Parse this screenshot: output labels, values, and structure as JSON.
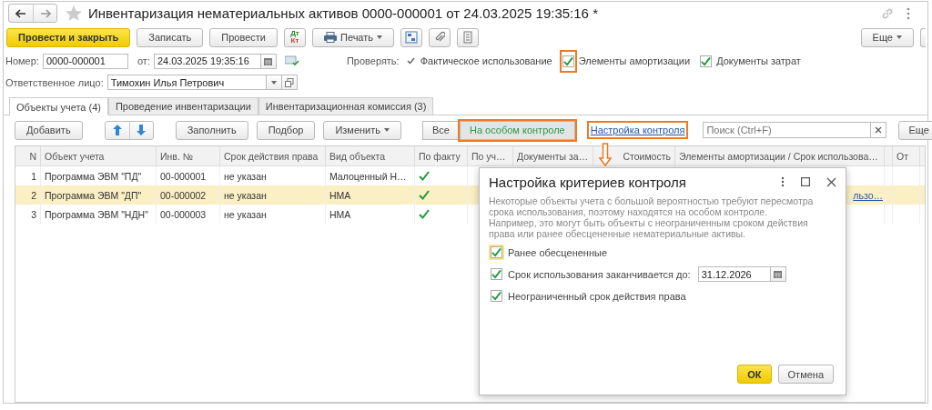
{
  "window": {
    "title": "Инвентаризация нематериальных активов 0000-000001 от 24.03.2025 19:35:16 *",
    "favorite": false
  },
  "toolbar": {
    "buttons": [
      {
        "kind": "primary",
        "label": "Провести и закрыть"
      },
      {
        "kind": "plain",
        "label": "Записать"
      },
      {
        "kind": "plain",
        "label": "Провести"
      },
      {
        "kind": "dtkt",
        "labels": [
          "Дт",
          "Кт"
        ]
      },
      {
        "kind": "print",
        "label": "Печать"
      },
      {
        "kind": "structure"
      },
      {
        "kind": "attach"
      },
      {
        "kind": "list"
      }
    ],
    "more": "Еще"
  },
  "header": {
    "number_label": "Номер:",
    "number": "0000-000001",
    "date_label": "от:",
    "date": "24.03.2025 19:35:16",
    "verify_label": "Проверять:",
    "checks": [
      {
        "kind": "mark",
        "label": "Фактическое использование",
        "checked": true
      },
      {
        "kind": "box",
        "label": "Элементы амортизации",
        "checked": true,
        "highlighted": true
      },
      {
        "kind": "box",
        "label": "Документы затрат",
        "checked": true,
        "highlighted": false
      }
    ],
    "responsible_label": "Ответственное лицо:",
    "responsible": "Тимохин Илья Петрович"
  },
  "tabs": [
    {
      "label": "Объекты учета (4)",
      "selected": true
    },
    {
      "label": "Проведение инвентаризации",
      "selected": false
    },
    {
      "label": "Инвентаризационная комиссия (3)",
      "selected": false
    }
  ],
  "table_toolbar": {
    "add": "Добавить",
    "fill": "Заполнить",
    "pick": "Подбор",
    "change": "Изменить",
    "filters": [
      {
        "label": "Все",
        "selected": false,
        "highlighted": false
      },
      {
        "label": "На особом контроле",
        "selected": true,
        "highlighted": true
      }
    ],
    "link": {
      "label": "Настройка контроля",
      "highlighted": true
    },
    "search_placeholder": "Поиск (Ctrl+F)",
    "more": "Еще"
  },
  "table": {
    "columns": [
      "N",
      "Объект учета",
      "Инв. №",
      "Срок действия права",
      "Вид объекта",
      "По факту",
      "По уч…",
      "Документы за…",
      "Стоимость",
      "Элементы амортизации / Срок использова…",
      "",
      "От"
    ],
    "rows": [
      {
        "n": "1",
        "object": "Программа ЭВМ  \"ПД\"",
        "inv": "00-000001",
        "term": "не указан",
        "type": "Малоценный Н…",
        "fact": true,
        "amort": "",
        "selected": false
      },
      {
        "n": "2",
        "object": "Программа ЭВМ  \"ДП\"",
        "inv": "00-000002",
        "term": "не указан",
        "type": "НМА",
        "fact": true,
        "amort": "льзо…",
        "selected": true
      },
      {
        "n": "3",
        "object": "Программа ЭВМ \"НДН\"",
        "inv": "00-000003",
        "term": "не указан",
        "type": "НМА",
        "fact": true,
        "amort": "",
        "selected": false
      }
    ]
  },
  "dialog": {
    "title": "Настройка критериев контроля",
    "text": [
      "Некоторые объекты учета с большой вероятностью требуют пересмотра срока использования, поэтому находятся на особом контроле.",
      "Например, это могут быть объекты с неограниченным сроком действия права или ранее обесцененные нематериальные активы."
    ],
    "options": [
      {
        "label": "Ранее обесцененные",
        "checked": true,
        "focused": true
      },
      {
        "label": "Срок использования заканчивается до:",
        "checked": true,
        "focused": false,
        "date": "31.12.2026"
      },
      {
        "label": "Неограниченный срок действия права",
        "checked": true,
        "focused": false
      }
    ],
    "ok": "ОК",
    "cancel": "Отмена"
  }
}
